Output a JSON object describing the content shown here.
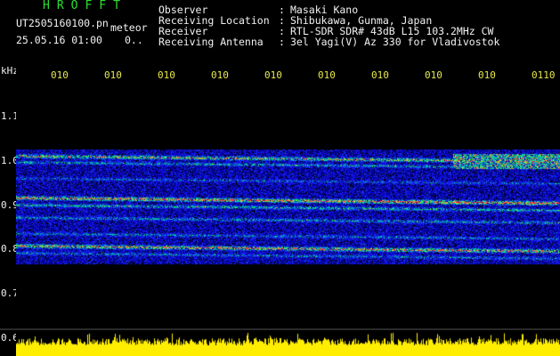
{
  "header": {
    "brand": "HROFFT",
    "filename": "UT2505160100.pn",
    "meteor_label": "meteor",
    "datetime": "25.05.16 01:00",
    "count": "0..",
    "info": [
      {
        "label": "Observer",
        "value": "Masaki Kano"
      },
      {
        "label": "Receiving Location",
        "value": "Shibukawa, Gunma, Japan"
      },
      {
        "label": "Receiver",
        "value": "RTL-SDR SDR# 43dB L15 103.2MHz CW"
      },
      {
        "label": "Receiving Antenna",
        "value": "3el Yagi(V) Az 330 for Vladivostok"
      }
    ]
  },
  "axis": {
    "unit": "kHz",
    "y_ticks": [
      "1.1",
      "1.0",
      "0.9",
      "0.8",
      "0.7",
      "0.6"
    ],
    "time_ticks": [
      "010",
      "010",
      "010",
      "010",
      "010",
      "010",
      "010",
      "010",
      "010",
      "0110"
    ]
  },
  "colors": {
    "background": "#000000",
    "header_green": "#29e12f",
    "text_white": "#f2f2f2",
    "tick_yellow": "#e8e84a",
    "noise_floor_yellow": "#ffee00",
    "spectrum_blue": "#1a1adc",
    "spectrum_red": "#ff3030"
  }
}
